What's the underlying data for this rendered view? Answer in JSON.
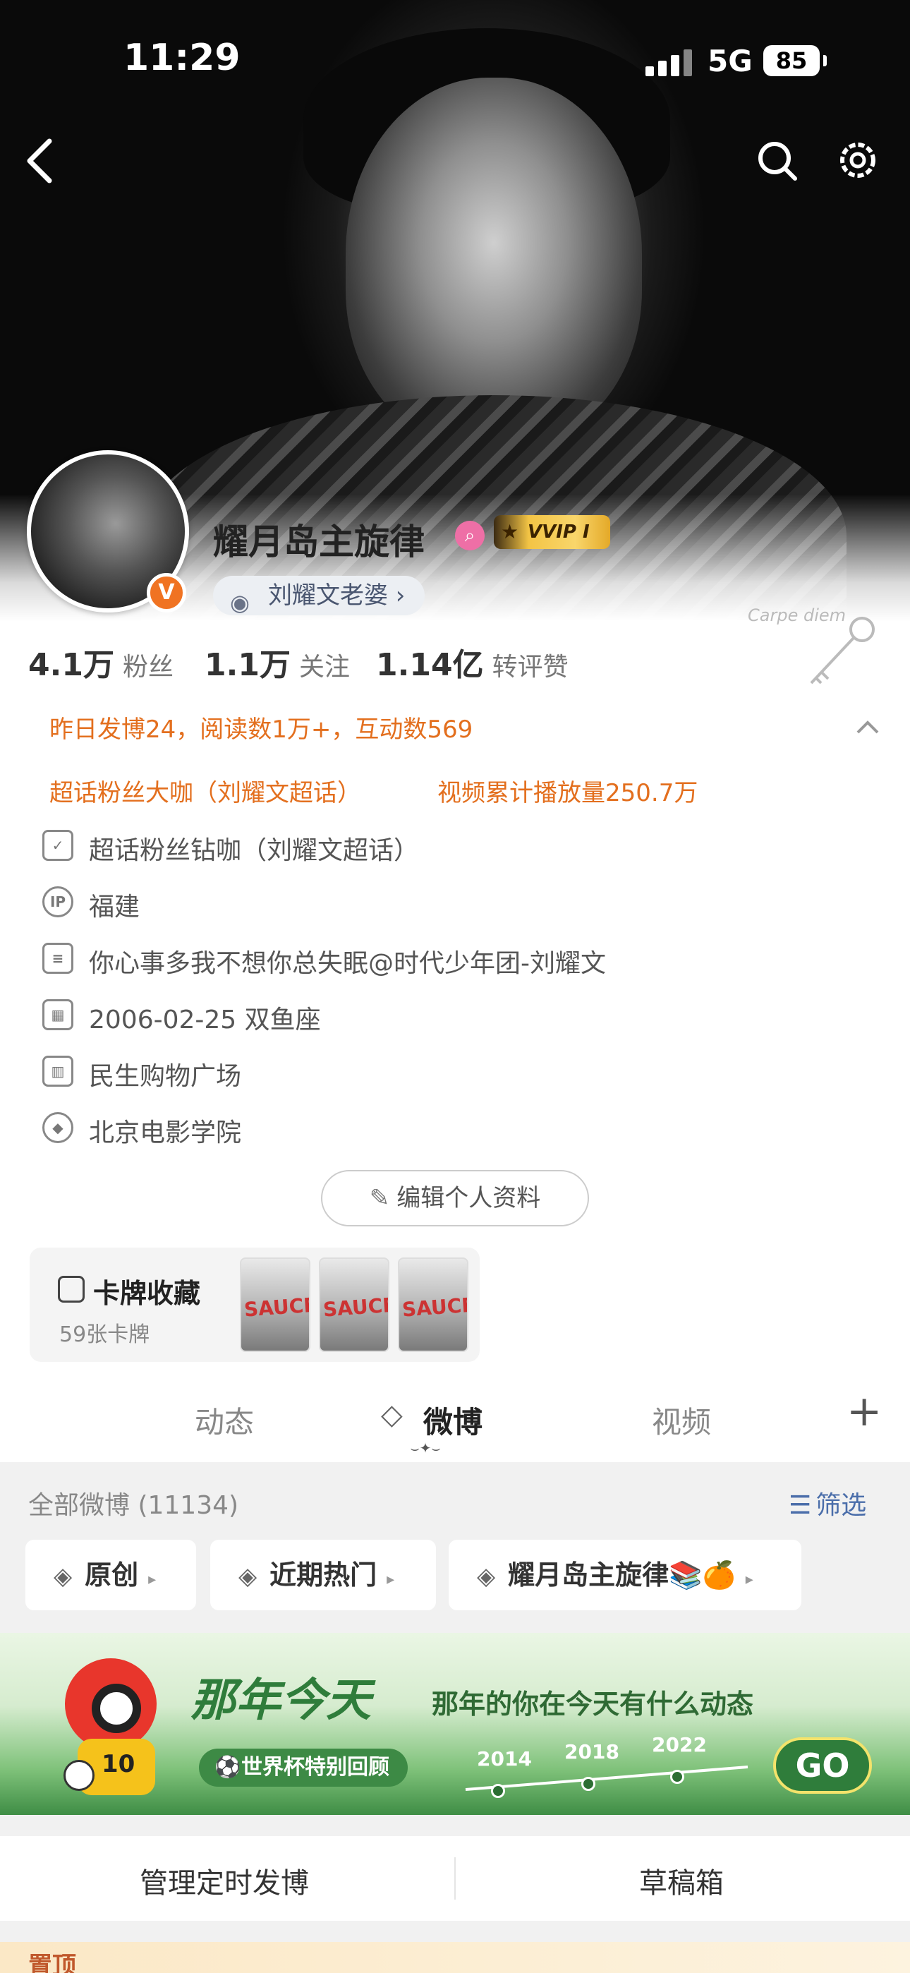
{
  "status_bar": {
    "time": "11:29",
    "network": "5G",
    "battery": "85"
  },
  "profile": {
    "username": "耀月岛主旋律",
    "vvip_label": "VVIP Ⅰ",
    "tag_label": "刘耀文老婆 ›",
    "card_watermark": "Carpe diem",
    "stats": [
      {
        "num": "4.1万",
        "label": "粉丝"
      },
      {
        "num": "1.1万",
        "label": "关注"
      },
      {
        "num": "1.14亿",
        "label": "转评赞"
      }
    ],
    "activity": "昨日发博24，阅读数1万+，互动数569",
    "honor_1": "超话粉丝大咖（刘耀文超话）",
    "honor_2": "视频累计播放量250.7万",
    "info": [
      {
        "icon": "shield-icon",
        "text": "超话粉丝钻咖（刘耀文超话）"
      },
      {
        "icon": "ip-icon",
        "text": "福建"
      },
      {
        "icon": "document-icon",
        "text": "你心事多我不想你总失眠@时代少年团-刘耀文"
      },
      {
        "icon": "calendar-icon",
        "text": "2006-02-25 双鱼座"
      },
      {
        "icon": "building-icon",
        "text": "民生购物广场"
      },
      {
        "icon": "graduation-icon",
        "text": "北京电影学院"
      }
    ],
    "edit_button": "编辑个人资料"
  },
  "cards": {
    "title": "卡牌收藏",
    "count": "59张卡牌",
    "thumb_text": "SAUCE"
  },
  "tabs": [
    "动态",
    "微博",
    "视频"
  ],
  "feed": {
    "all_count": "全部微博 (11134)",
    "filter": "筛选",
    "chips": [
      "原创",
      "近期热门",
      "耀月岛主旋律📚🍊"
    ]
  },
  "banner": {
    "title": "那年今天",
    "subtitle": "那年的你在今天有什么动态",
    "pill": "世界杯特别回顾",
    "years": [
      "2014",
      "2018",
      "2022"
    ],
    "go": "GO",
    "jersey_number": "10"
  },
  "bottom": {
    "scheduled": "管理定时发博",
    "drafts": "草稿箱"
  },
  "pinned": "置顶"
}
